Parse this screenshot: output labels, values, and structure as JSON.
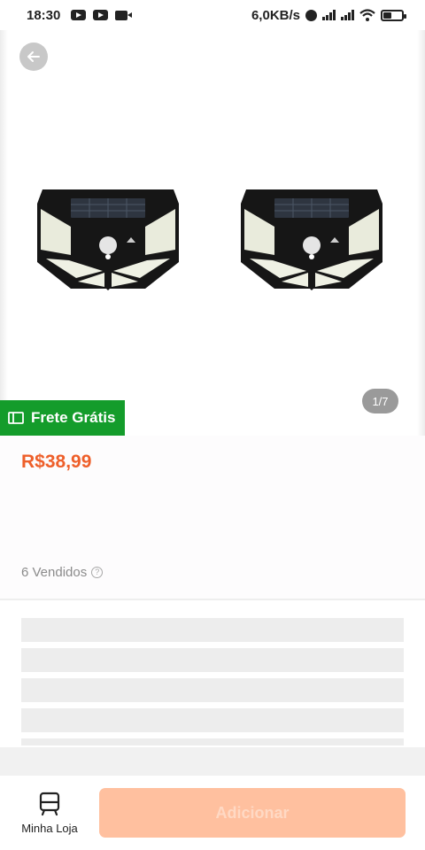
{
  "status_bar": {
    "time": "18:30",
    "network_speed": "6,0KB/s",
    "icons": [
      "youtube-icon",
      "youtube-icon",
      "camera-icon",
      "alarm-icon",
      "signal-icon",
      "signal-icon",
      "wifi-icon",
      "battery-icon"
    ]
  },
  "gallery": {
    "counter": "1/7",
    "back_icon": "arrow-left-icon",
    "images": [
      "solar-wall-light",
      "solar-wall-light"
    ]
  },
  "shipping": {
    "label": "Frete Grátis",
    "icon": "ticket-icon",
    "color": "#149c2b"
  },
  "product": {
    "price": "R$38,99",
    "price_color": "#ee5f2a",
    "sold": "6 Vendidos",
    "help_icon": "question-circle-icon"
  },
  "bottom_bar": {
    "store_label": "Minha Loja",
    "store_icon": "store-icon",
    "add_label": "Adicionar",
    "add_color": "#ffc09f"
  }
}
